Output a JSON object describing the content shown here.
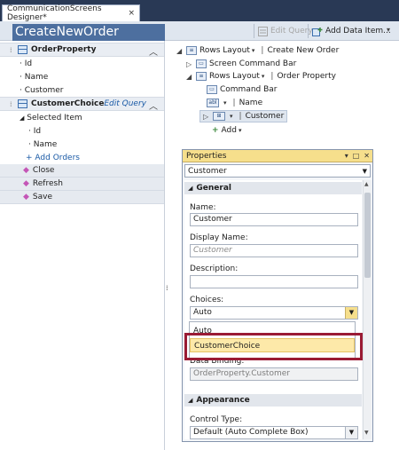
{
  "document_tab": {
    "label": "CommunicationScreens Designer*",
    "close": "×"
  },
  "header": {
    "screen_title": "CreateNewOrder",
    "edit_query_label": "Edit Query",
    "add_data_item_label": "Add Data Item..."
  },
  "left_pane": {
    "groups": [
      {
        "name": "OrderProperty",
        "items": [
          "Id",
          "Name",
          "Customer"
        ]
      },
      {
        "name": "CustomerChoice",
        "edit_query_label": "Edit Query",
        "subgroup": "Selected Item",
        "sub_items": [
          "Id",
          "Name"
        ],
        "add_label": "Add Orders"
      }
    ],
    "methods": [
      "Close",
      "Refresh",
      "Save"
    ]
  },
  "tree": {
    "rows_layout_1": "Rows Layout",
    "rows_layout_1_name": "Create New Order",
    "screen_command_bar": "Screen Command Bar",
    "rows_layout_2": "Rows Layout",
    "rows_layout_2_name": "Order Property",
    "command_bar": "Command Bar",
    "name_field": "Name",
    "name_icon": "abl",
    "customer_field": "Customer",
    "add_label": "Add"
  },
  "properties": {
    "title": "Properties",
    "object": "Customer",
    "categories": {
      "general": "General",
      "appearance": "Appearance"
    },
    "name_label": "Name:",
    "name_value": "Customer",
    "display_name_label": "Display Name:",
    "display_name_placeholder": "Customer",
    "description_label": "Description:",
    "description_value": "",
    "choices_label": "Choices:",
    "choices_value": "Auto",
    "choices_options": [
      "Auto",
      "CustomerChoice"
    ],
    "data_binding_label": "Data Binding:",
    "data_binding_value": "OrderProperty.Customer",
    "control_type_label": "Control Type:",
    "control_type_value": "Default (Auto Complete Box)"
  },
  "colors": {
    "tab_strip": "#293955",
    "title_bg": "#4d6f9f",
    "properties_title": "#f6df8c",
    "highlight": "#fde9a9",
    "callout_border": "#9a1b34",
    "link": "#1a5aa6"
  }
}
